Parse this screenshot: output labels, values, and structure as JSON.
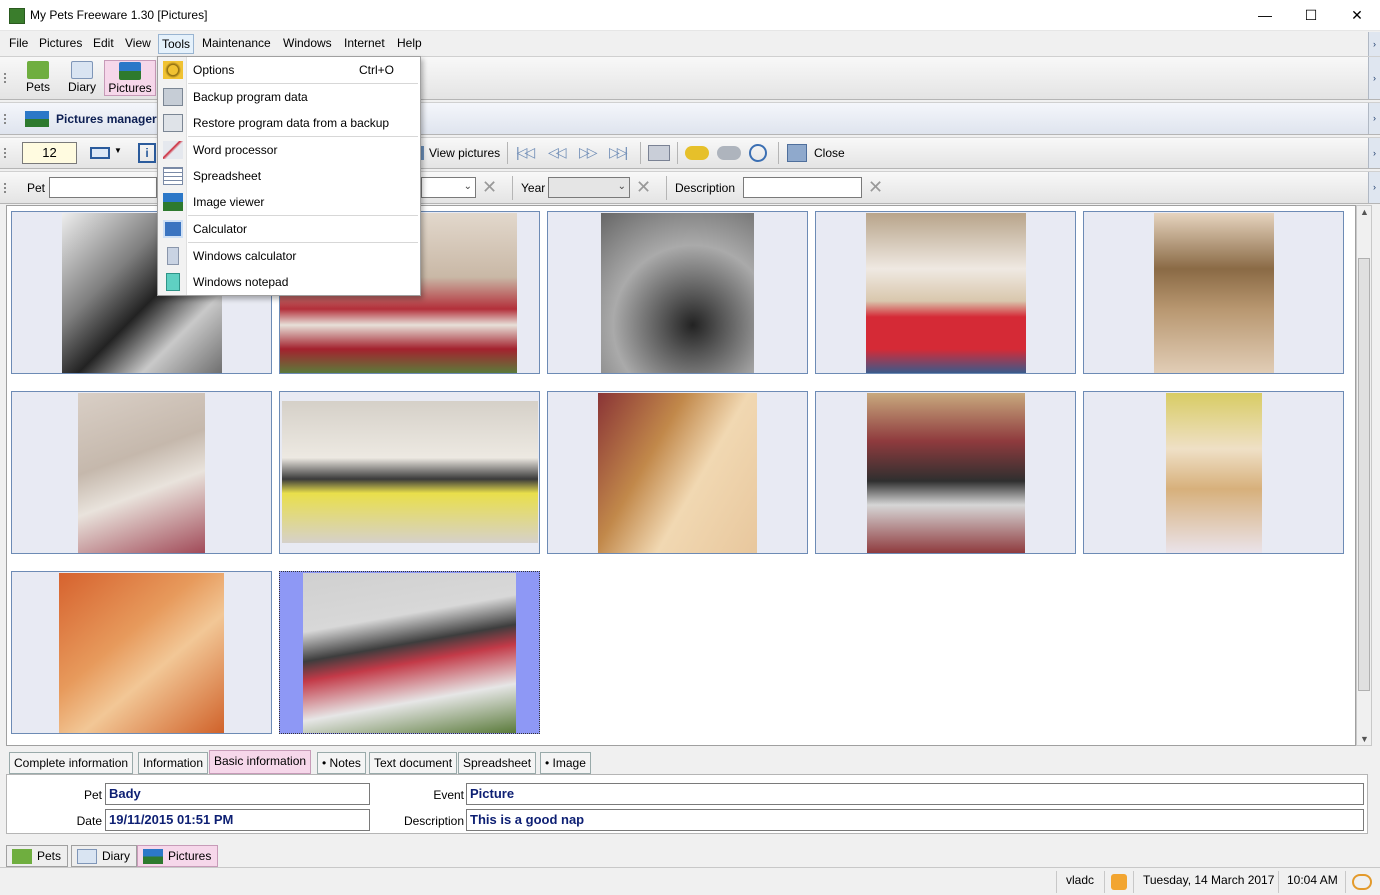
{
  "window": {
    "title": "My Pets Freeware 1.30 [Pictures]",
    "minimize": "—",
    "maximize": "☐",
    "close": "✕"
  },
  "menu": [
    "File",
    "Pictures",
    "Edit",
    "View",
    "Tools",
    "Maintenance",
    "Windows",
    "Internet",
    "Help"
  ],
  "nav_toolbar": {
    "pets": "Pets",
    "diary": "Diary",
    "pictures": "Pictures"
  },
  "panel": {
    "title": "Pictures manager"
  },
  "toolbar2": {
    "count": "12",
    "view_pictures": "View pictures",
    "close": "Close"
  },
  "filter": {
    "pet_label": "Pet",
    "year_label": "Year",
    "description_label": "Description",
    "pet_value": "",
    "description_value": ""
  },
  "tools_menu": [
    {
      "label": "Options",
      "shortcut": "Ctrl+O",
      "icon": "gear-icon"
    },
    {
      "label": "Backup program data",
      "icon": "backup-icon"
    },
    {
      "label": "Restore program data from a backup",
      "icon": "restore-icon"
    },
    {
      "label": "Word processor",
      "icon": "word-processor-icon"
    },
    {
      "label": "Spreadsheet",
      "icon": "spreadsheet-icon"
    },
    {
      "label": "Image viewer",
      "icon": "image-viewer-icon"
    },
    {
      "label": "Calculator",
      "icon": "calculator-icon"
    },
    {
      "label": "Windows calculator",
      "icon": "windows-calculator-icon"
    },
    {
      "label": "Windows notepad",
      "icon": "notepad-icon"
    }
  ],
  "tabs": [
    "Complete information",
    "Information",
    "Basic information",
    "• Notes",
    "Text document",
    "Spreadsheet",
    "• Image"
  ],
  "info": {
    "pet_label": "Pet",
    "pet_value": "Bady",
    "date_label": "Date",
    "date_value": "19/11/2015 01:51 PM",
    "event_label": "Event",
    "event_value": "Picture",
    "description_label": "Description",
    "description_value": "This is a good nap"
  },
  "bottom_tabs": [
    "Pets",
    "Diary",
    "Pictures"
  ],
  "status": {
    "user": "vladc",
    "date": "Tuesday, 14 March 2017",
    "time": "10:04 AM"
  },
  "colors": {
    "accent": "#f6d7ea",
    "value_text": "#0d1f73",
    "selected_tile": "#8e98f5"
  }
}
